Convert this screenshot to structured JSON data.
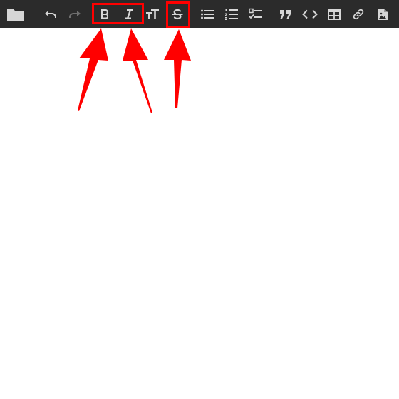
{
  "toolbar": {
    "accent": "#ff0000",
    "background": "#2b2b2b",
    "buttons": [
      {
        "id": "open-folder",
        "icon": "folder-icon",
        "enabled": true
      },
      {
        "id": "undo",
        "icon": "undo-icon",
        "enabled": true
      },
      {
        "id": "redo",
        "icon": "redo-icon",
        "enabled": false
      },
      {
        "id": "bold",
        "icon": "bold-icon",
        "enabled": true,
        "highlighted": true
      },
      {
        "id": "italic",
        "icon": "italic-icon",
        "enabled": true,
        "highlighted": true
      },
      {
        "id": "text-size",
        "icon": "text-size-icon",
        "enabled": true
      },
      {
        "id": "strikethrough",
        "icon": "strikethrough-icon",
        "enabled": true,
        "highlighted": true
      },
      {
        "id": "bulleted-list",
        "icon": "bulleted-list-icon",
        "enabled": true
      },
      {
        "id": "numbered-list",
        "icon": "numbered-list-icon",
        "enabled": true
      },
      {
        "id": "checklist",
        "icon": "checklist-icon",
        "enabled": true
      },
      {
        "id": "quote",
        "icon": "quote-icon",
        "enabled": true
      },
      {
        "id": "code",
        "icon": "code-icon",
        "enabled": true
      },
      {
        "id": "table",
        "icon": "table-icon",
        "enabled": true
      },
      {
        "id": "link",
        "icon": "link-icon",
        "enabled": true
      },
      {
        "id": "image",
        "icon": "image-icon",
        "enabled": true
      }
    ]
  },
  "annotations": {
    "color": "#ff0000",
    "arrows": 3
  }
}
